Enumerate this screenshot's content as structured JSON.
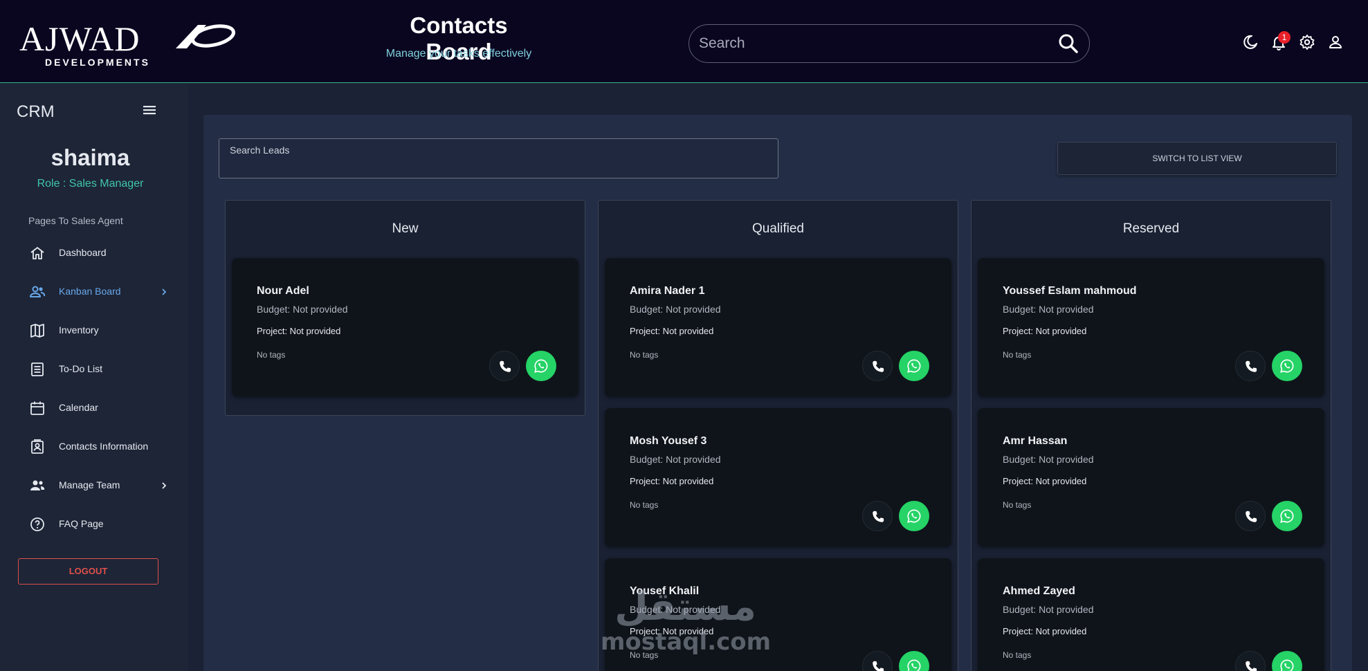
{
  "brand": {
    "logo_text": "AJWAD",
    "logo_subtitle": "DEVELOPMENTS"
  },
  "header": {
    "title": "Contacts Board",
    "subtitle": "Manage your tasks effectively",
    "search_placeholder": "Search",
    "notification_count": "1",
    "icons": [
      "moon-icon",
      "bell-icon",
      "gear-icon",
      "user-icon"
    ]
  },
  "sidebar": {
    "app_name": "CRM",
    "user_name": "shaima",
    "user_role": "Role : Sales Manager",
    "section_label": "Pages To Sales Agent",
    "items": [
      {
        "label": "Dashboard",
        "icon": "home-icon",
        "active": false,
        "has_submenu": false
      },
      {
        "label": "Kanban Board",
        "icon": "users-icon",
        "active": true,
        "has_submenu": true
      },
      {
        "label": "Inventory",
        "icon": "map-icon",
        "active": false,
        "has_submenu": false
      },
      {
        "label": "To-Do List",
        "icon": "list-icon",
        "active": false,
        "has_submenu": false
      },
      {
        "label": "Calendar",
        "icon": "calendar-icon",
        "active": false,
        "has_submenu": false
      },
      {
        "label": "Contacts Information",
        "icon": "contact-card-icon",
        "active": false,
        "has_submenu": false
      },
      {
        "label": "Manage Team",
        "icon": "team-icon",
        "active": false,
        "has_submenu": true
      },
      {
        "label": "FAQ Page",
        "icon": "help-icon",
        "active": false,
        "has_submenu": false
      }
    ],
    "logout_label": "LOGOUT"
  },
  "main": {
    "lead_search_label": "Search Leads",
    "switch_view_label": "SWITCH TO LIST VIEW",
    "columns": [
      {
        "title": "New",
        "cards": [
          {
            "name": "Nour Adel",
            "budget": "Budget: Not provided",
            "project": "Project: Not provided",
            "tags": "No tags"
          }
        ]
      },
      {
        "title": "Qualified",
        "cards": [
          {
            "name": "Amira Nader 1",
            "budget": "Budget: Not provided",
            "project": "Project: Not provided",
            "tags": "No tags"
          },
          {
            "name": "Mosh Yousef 3",
            "budget": "Budget: Not provided",
            "project": "Project: Not provided",
            "tags": "No tags"
          },
          {
            "name": "Yousef Khalil",
            "budget": "Budget: Not provided",
            "project": "Project: Not provided",
            "tags": "No tags"
          }
        ]
      },
      {
        "title": "Reserved",
        "cards": [
          {
            "name": "Youssef Eslam mahmoud",
            "budget": "Budget: Not provided",
            "project": "Project: Not provided",
            "tags": "No tags"
          },
          {
            "name": "Amr Hassan",
            "budget": "Budget: Not provided",
            "project": "Project: Not provided",
            "tags": "No tags"
          },
          {
            "name": "Ahmed Zayed",
            "budget": "Budget: Not provided",
            "project": "Project: Not provided",
            "tags": "No tags"
          }
        ]
      }
    ]
  },
  "watermark": {
    "arabic": "مستقل",
    "latin": "mostaql.com"
  },
  "colors": {
    "header_bg": "#0a0620",
    "sidebar_bg": "#1d2537",
    "accent_teal": "#41c6a8",
    "active_blue": "#69a8e9",
    "whatsapp_green": "#25d366",
    "logout_red": "#e0504a",
    "badge_red": "#e8202a"
  }
}
